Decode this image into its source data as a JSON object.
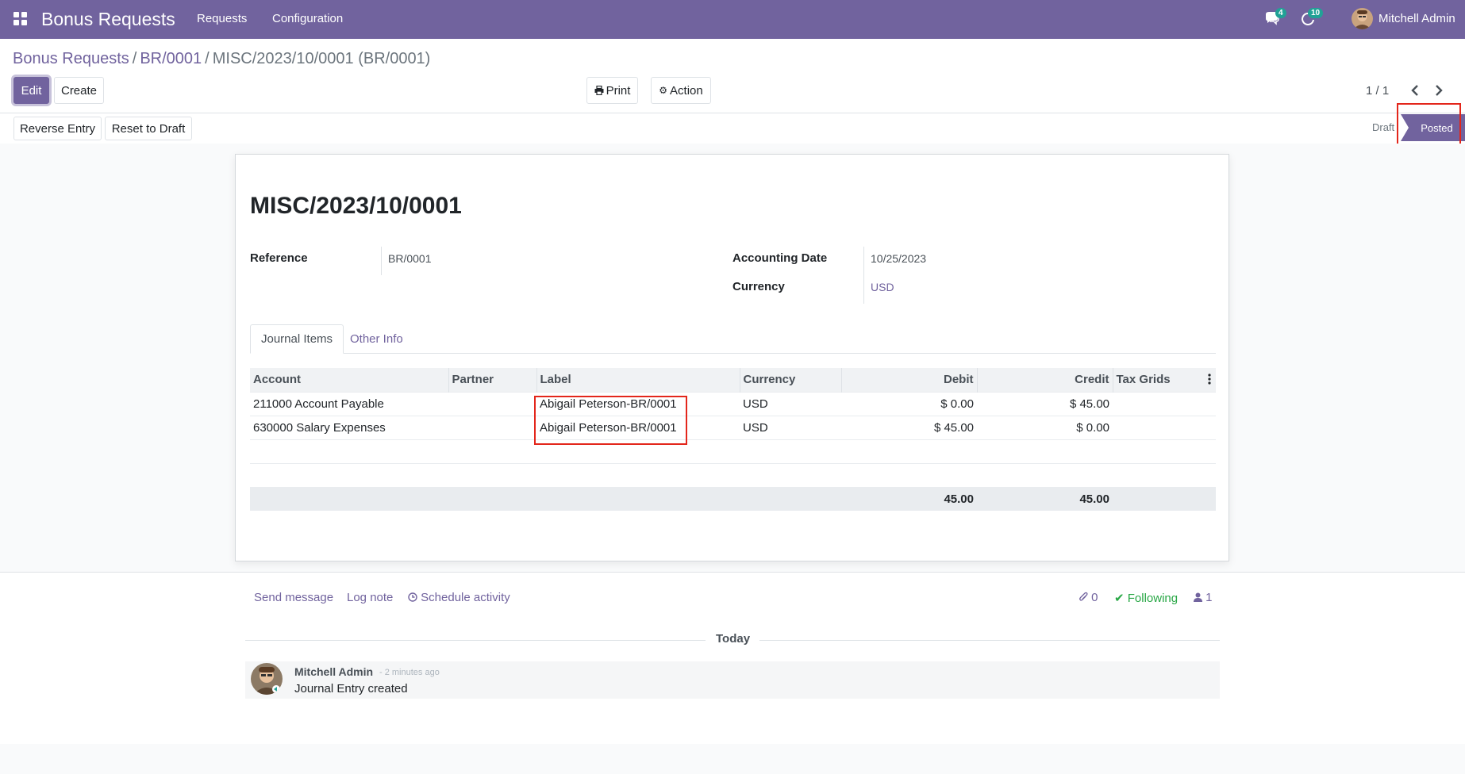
{
  "navbar": {
    "app_name": "Bonus Requests",
    "menu": [
      "Requests",
      "Configuration"
    ],
    "messages_count": "4",
    "activities_count": "10",
    "user_name": "Mitchell Admin",
    "color": "#71639e"
  },
  "breadcrumb": {
    "items": [
      "Bonus Requests",
      "BR/0001"
    ],
    "current": "MISC/2023/10/0001 (BR/0001)"
  },
  "toolbar": {
    "edit": "Edit",
    "create": "Create",
    "print": "Print",
    "action": "Action",
    "pager": "1 / 1"
  },
  "statusbar": {
    "buttons": [
      "Reverse Entry",
      "Reset to Draft"
    ],
    "states": [
      "Draft",
      "Posted"
    ],
    "current_state": "Posted"
  },
  "form": {
    "title": "MISC/2023/10/0001",
    "reference_label": "Reference",
    "reference": "BR/0001",
    "accounting_date_label": "Accounting Date",
    "accounting_date": "10/25/2023",
    "currency_label": "Currency",
    "currency": "USD",
    "tabs": [
      "Journal Items",
      "Other Info"
    ]
  },
  "journal": {
    "headers": [
      "Account",
      "Partner",
      "Label",
      "Currency",
      "Debit",
      "Credit",
      "Tax Grids"
    ],
    "rows": [
      {
        "account": "211000 Account Payable",
        "partner": "",
        "label": "Abigail Peterson-BR/0001",
        "currency": "USD",
        "debit": "$ 0.00",
        "credit": "$ 45.00",
        "tax_grids": ""
      },
      {
        "account": "630000 Salary Expenses",
        "partner": "",
        "label": "Abigail Peterson-BR/0001",
        "currency": "USD",
        "debit": "$ 45.00",
        "credit": "$ 0.00",
        "tax_grids": ""
      }
    ],
    "total_debit": "45.00",
    "total_credit": "45.00"
  },
  "chatter": {
    "send_message": "Send message",
    "log_note": "Log note",
    "schedule_activity": "Schedule activity",
    "attachments": "0",
    "following": "Following",
    "followers": "1",
    "date_separator": "Today",
    "message": {
      "author": "Mitchell Admin",
      "time": "- 2 minutes ago",
      "body": "Journal Entry created"
    }
  }
}
